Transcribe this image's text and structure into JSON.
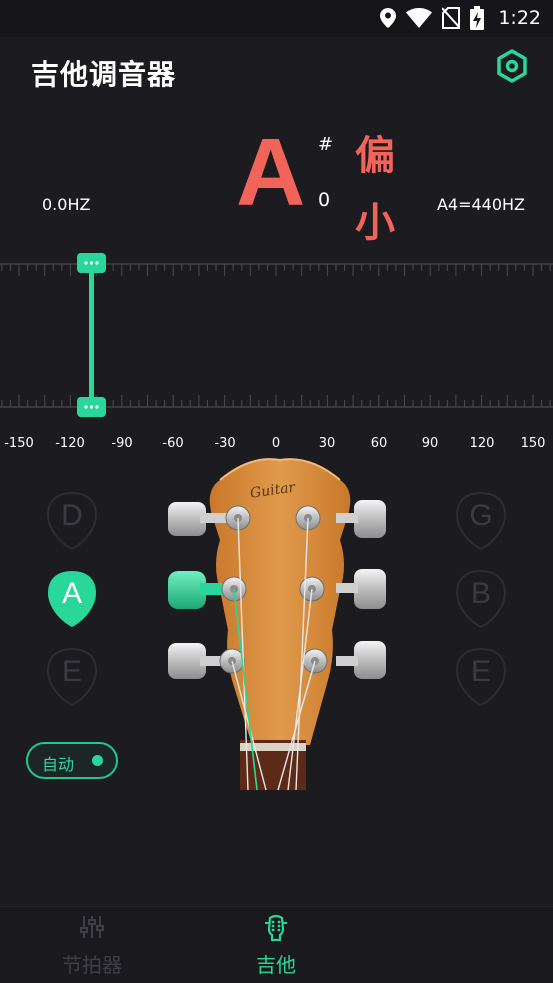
{
  "status_bar": {
    "time": "1:22",
    "icons": [
      "location-icon",
      "wifi-icon",
      "no-sim-icon",
      "battery-charging-icon"
    ]
  },
  "header": {
    "title": "吉他调音器",
    "settings_icon": "settings-icon"
  },
  "tuner": {
    "current_freq": "0.0HZ",
    "reference": "A4=440HZ",
    "note": "A",
    "sharp": "#",
    "octave": "0",
    "status_line1": "偏",
    "status_line2": "小",
    "deviation_cents": -110
  },
  "scale": {
    "labels": [
      "-150",
      "-120",
      "-90",
      "-60",
      "-30",
      "0",
      "30",
      "60",
      "90",
      "120",
      "150"
    ]
  },
  "strings": {
    "left": [
      "D",
      "A",
      "E"
    ],
    "right": [
      "G",
      "B",
      "E"
    ],
    "active": "A"
  },
  "guitar": {
    "brand": "Guitar"
  },
  "auto_toggle": {
    "label": "自动",
    "on": true
  },
  "nav": {
    "items": [
      {
        "label": "节拍器",
        "icon": "sliders-icon"
      },
      {
        "label": "吉他",
        "icon": "guitar-head-icon"
      }
    ],
    "active": "吉他"
  },
  "colors": {
    "accent": "#2ad79a",
    "warning": "#f2635a",
    "background": "#1c1c20"
  }
}
